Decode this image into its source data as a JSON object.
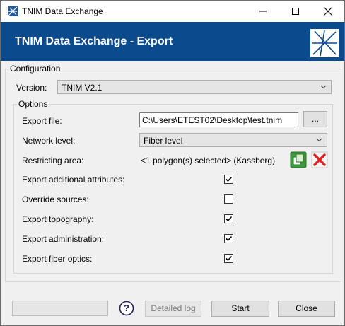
{
  "window": {
    "title": "TNIM Data Exchange"
  },
  "header": {
    "title": "TNIM Data Exchange - Export"
  },
  "configuration": {
    "group_label": "Configuration",
    "version_label": "Version:",
    "version_value": "TNIM V2.1"
  },
  "options": {
    "group_label": "Options",
    "export_file_label": "Export file:",
    "export_file_value": "C:\\Users\\ETEST02\\Desktop\\test.tnim",
    "browse_label": "...",
    "network_level_label": "Network level:",
    "network_level_value": "Fiber level",
    "restricting_area_label": "Restricting area:",
    "restricting_area_value": "<1 polygon(s) selected> (Kassberg)",
    "checkboxes": [
      {
        "label": "Export additional attributes:",
        "checked": true
      },
      {
        "label": "Override sources:",
        "checked": false
      },
      {
        "label": "Export topography:",
        "checked": true
      },
      {
        "label": "Export administration:",
        "checked": true
      },
      {
        "label": "Export fiber optics:",
        "checked": true
      }
    ]
  },
  "footer": {
    "detailed_log_label": "Detailed log",
    "start_label": "Start",
    "close_label": "Close",
    "help_label": "?"
  },
  "colors": {
    "header_bg": "#0b4a8d",
    "delete_red": "#e02020",
    "select_green": "#3c9a3c"
  },
  "icons": [
    "app-icon",
    "minimize-icon",
    "maximize-icon",
    "close-icon",
    "chevron-down-icon",
    "select-area-icon",
    "delete-icon",
    "help-icon"
  ]
}
